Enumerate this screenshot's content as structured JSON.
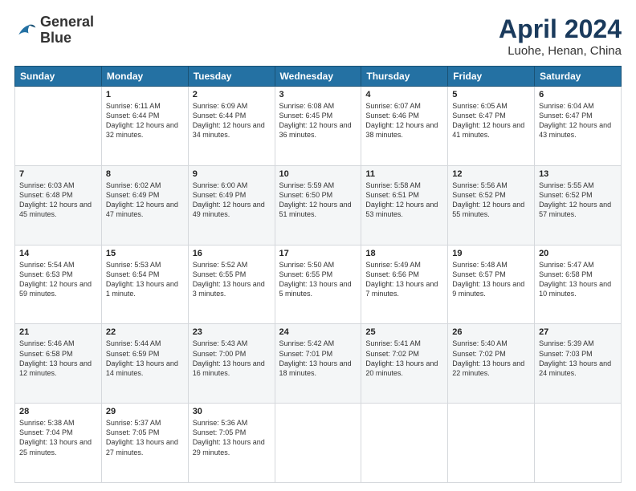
{
  "logo": {
    "line1": "General",
    "line2": "Blue"
  },
  "title": {
    "month_year": "April 2024",
    "location": "Luohe, Henan, China"
  },
  "header_days": [
    "Sunday",
    "Monday",
    "Tuesday",
    "Wednesday",
    "Thursday",
    "Friday",
    "Saturday"
  ],
  "weeks": [
    [
      {
        "day": "",
        "rise": "",
        "set": "",
        "daylight": ""
      },
      {
        "day": "1",
        "rise": "Sunrise: 6:11 AM",
        "set": "Sunset: 6:44 PM",
        "daylight": "Daylight: 12 hours and 32 minutes."
      },
      {
        "day": "2",
        "rise": "Sunrise: 6:09 AM",
        "set": "Sunset: 6:44 PM",
        "daylight": "Daylight: 12 hours and 34 minutes."
      },
      {
        "day": "3",
        "rise": "Sunrise: 6:08 AM",
        "set": "Sunset: 6:45 PM",
        "daylight": "Daylight: 12 hours and 36 minutes."
      },
      {
        "day": "4",
        "rise": "Sunrise: 6:07 AM",
        "set": "Sunset: 6:46 PM",
        "daylight": "Daylight: 12 hours and 38 minutes."
      },
      {
        "day": "5",
        "rise": "Sunrise: 6:05 AM",
        "set": "Sunset: 6:47 PM",
        "daylight": "Daylight: 12 hours and 41 minutes."
      },
      {
        "day": "6",
        "rise": "Sunrise: 6:04 AM",
        "set": "Sunset: 6:47 PM",
        "daylight": "Daylight: 12 hours and 43 minutes."
      }
    ],
    [
      {
        "day": "7",
        "rise": "Sunrise: 6:03 AM",
        "set": "Sunset: 6:48 PM",
        "daylight": "Daylight: 12 hours and 45 minutes."
      },
      {
        "day": "8",
        "rise": "Sunrise: 6:02 AM",
        "set": "Sunset: 6:49 PM",
        "daylight": "Daylight: 12 hours and 47 minutes."
      },
      {
        "day": "9",
        "rise": "Sunrise: 6:00 AM",
        "set": "Sunset: 6:49 PM",
        "daylight": "Daylight: 12 hours and 49 minutes."
      },
      {
        "day": "10",
        "rise": "Sunrise: 5:59 AM",
        "set": "Sunset: 6:50 PM",
        "daylight": "Daylight: 12 hours and 51 minutes."
      },
      {
        "day": "11",
        "rise": "Sunrise: 5:58 AM",
        "set": "Sunset: 6:51 PM",
        "daylight": "Daylight: 12 hours and 53 minutes."
      },
      {
        "day": "12",
        "rise": "Sunrise: 5:56 AM",
        "set": "Sunset: 6:52 PM",
        "daylight": "Daylight: 12 hours and 55 minutes."
      },
      {
        "day": "13",
        "rise": "Sunrise: 5:55 AM",
        "set": "Sunset: 6:52 PM",
        "daylight": "Daylight: 12 hours and 57 minutes."
      }
    ],
    [
      {
        "day": "14",
        "rise": "Sunrise: 5:54 AM",
        "set": "Sunset: 6:53 PM",
        "daylight": "Daylight: 12 hours and 59 minutes."
      },
      {
        "day": "15",
        "rise": "Sunrise: 5:53 AM",
        "set": "Sunset: 6:54 PM",
        "daylight": "Daylight: 13 hours and 1 minute."
      },
      {
        "day": "16",
        "rise": "Sunrise: 5:52 AM",
        "set": "Sunset: 6:55 PM",
        "daylight": "Daylight: 13 hours and 3 minutes."
      },
      {
        "day": "17",
        "rise": "Sunrise: 5:50 AM",
        "set": "Sunset: 6:55 PM",
        "daylight": "Daylight: 13 hours and 5 minutes."
      },
      {
        "day": "18",
        "rise": "Sunrise: 5:49 AM",
        "set": "Sunset: 6:56 PM",
        "daylight": "Daylight: 13 hours and 7 minutes."
      },
      {
        "day": "19",
        "rise": "Sunrise: 5:48 AM",
        "set": "Sunset: 6:57 PM",
        "daylight": "Daylight: 13 hours and 9 minutes."
      },
      {
        "day": "20",
        "rise": "Sunrise: 5:47 AM",
        "set": "Sunset: 6:58 PM",
        "daylight": "Daylight: 13 hours and 10 minutes."
      }
    ],
    [
      {
        "day": "21",
        "rise": "Sunrise: 5:46 AM",
        "set": "Sunset: 6:58 PM",
        "daylight": "Daylight: 13 hours and 12 minutes."
      },
      {
        "day": "22",
        "rise": "Sunrise: 5:44 AM",
        "set": "Sunset: 6:59 PM",
        "daylight": "Daylight: 13 hours and 14 minutes."
      },
      {
        "day": "23",
        "rise": "Sunrise: 5:43 AM",
        "set": "Sunset: 7:00 PM",
        "daylight": "Daylight: 13 hours and 16 minutes."
      },
      {
        "day": "24",
        "rise": "Sunrise: 5:42 AM",
        "set": "Sunset: 7:01 PM",
        "daylight": "Daylight: 13 hours and 18 minutes."
      },
      {
        "day": "25",
        "rise": "Sunrise: 5:41 AM",
        "set": "Sunset: 7:02 PM",
        "daylight": "Daylight: 13 hours and 20 minutes."
      },
      {
        "day": "26",
        "rise": "Sunrise: 5:40 AM",
        "set": "Sunset: 7:02 PM",
        "daylight": "Daylight: 13 hours and 22 minutes."
      },
      {
        "day": "27",
        "rise": "Sunrise: 5:39 AM",
        "set": "Sunset: 7:03 PM",
        "daylight": "Daylight: 13 hours and 24 minutes."
      }
    ],
    [
      {
        "day": "28",
        "rise": "Sunrise: 5:38 AM",
        "set": "Sunset: 7:04 PM",
        "daylight": "Daylight: 13 hours and 25 minutes."
      },
      {
        "day": "29",
        "rise": "Sunrise: 5:37 AM",
        "set": "Sunset: 7:05 PM",
        "daylight": "Daylight: 13 hours and 27 minutes."
      },
      {
        "day": "30",
        "rise": "Sunrise: 5:36 AM",
        "set": "Sunset: 7:05 PM",
        "daylight": "Daylight: 13 hours and 29 minutes."
      },
      {
        "day": "",
        "rise": "",
        "set": "",
        "daylight": ""
      },
      {
        "day": "",
        "rise": "",
        "set": "",
        "daylight": ""
      },
      {
        "day": "",
        "rise": "",
        "set": "",
        "daylight": ""
      },
      {
        "day": "",
        "rise": "",
        "set": "",
        "daylight": ""
      }
    ]
  ]
}
